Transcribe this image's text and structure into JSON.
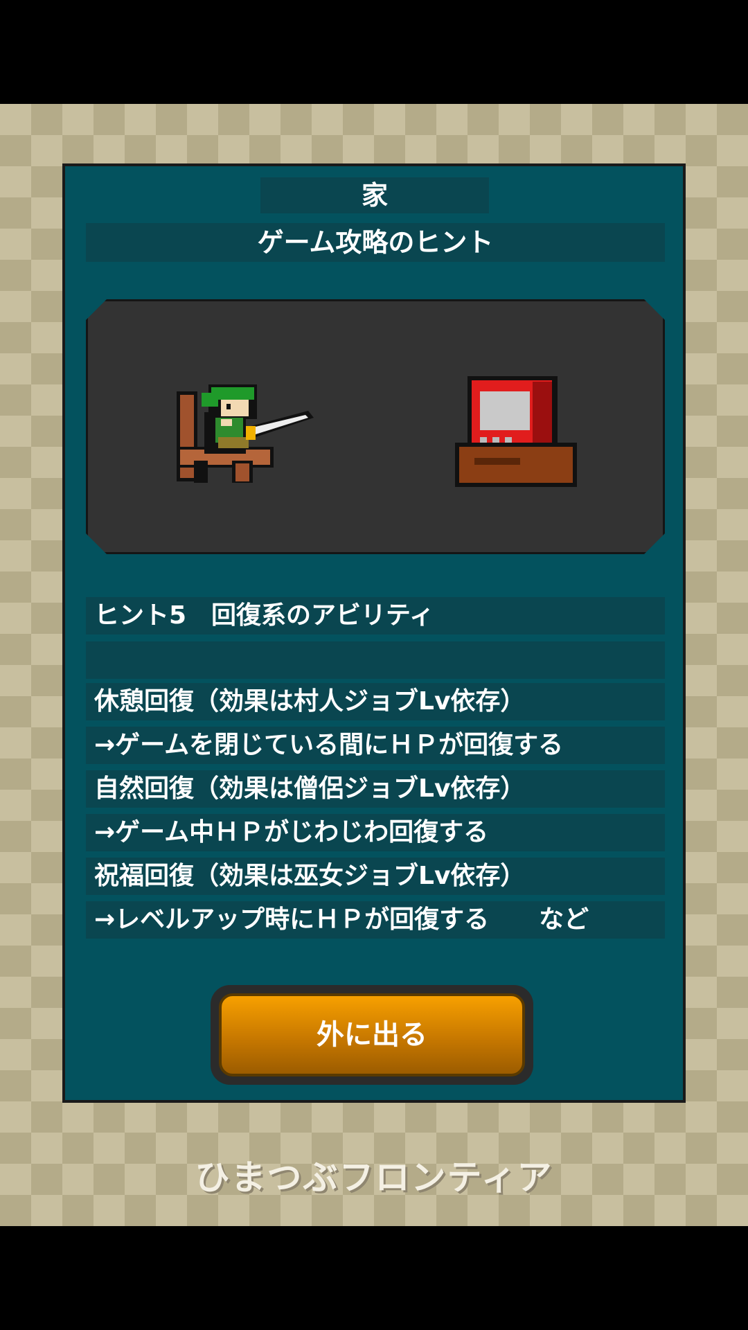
{
  "header": {
    "location": "家",
    "subtitle": "ゲーム攻略のヒント"
  },
  "hint": {
    "title": "ヒント5　回復系のアビリティ",
    "blank": "",
    "lines": [
      "休憩回復（効果は村人ジョブLv依存）",
      "→ゲームを閉じている間にＨＰが回復する",
      "自然回復（効果は僧侶ジョブLv依存）",
      "→ゲーム中ＨＰがじわじわ回復する",
      "祝福回復（効果は巫女ジョブLv依存）",
      "→レベルアップ時にＨＰが回復する　　など"
    ]
  },
  "buttons": {
    "exit_label": "外に出る"
  },
  "footer": {
    "logo": "ひまつぶフロンティア"
  },
  "colors": {
    "panel": "#03525e",
    "band": "#0a4650",
    "button": "#e08c00",
    "checker_light": "#c8bf9f",
    "checker_dark": "#b4ab89"
  }
}
